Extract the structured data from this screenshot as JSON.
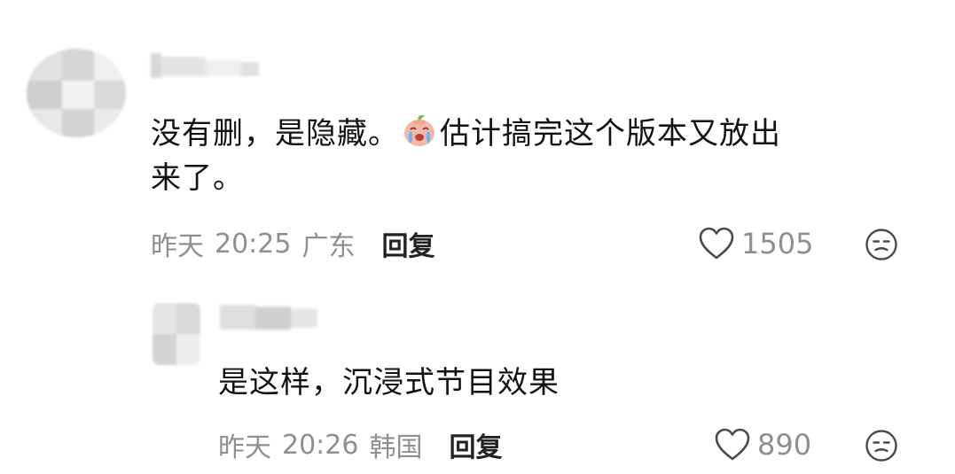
{
  "comments": [
    {
      "content_line1_a": "没有删，是隐藏。",
      "emoji": "crying-face-emoji",
      "content_line1_b": "估计搞完这个版本又放出",
      "content_line2": "来了。",
      "date": "昨天",
      "time": "20:25",
      "location": "广东",
      "reply_label": "回复",
      "likes": "1505"
    },
    {
      "content": "是这样，沉浸式节目效果",
      "date": "昨天",
      "time": "20:26",
      "location": "韩国",
      "reply_label": "回复",
      "likes": "890"
    }
  ],
  "icons": {
    "like": "heart-outline-icon",
    "dislike": "meh-face-icon"
  },
  "colors": {
    "text": "#131313",
    "meta": "#8f8f8f",
    "reply": "#222222"
  }
}
